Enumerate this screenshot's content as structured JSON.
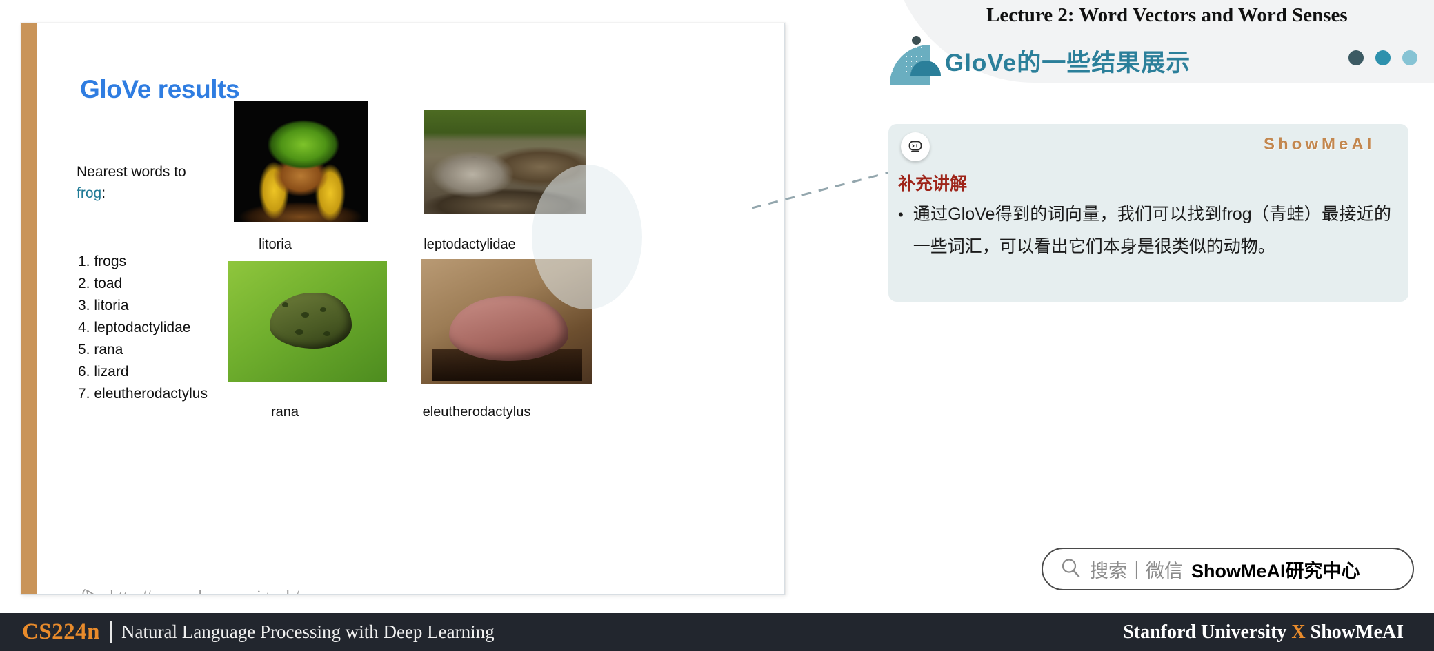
{
  "header": {
    "lecture_title": "Lecture 2:  Word Vectors and Word Senses",
    "cn_title": "GloVe的一些结果展示",
    "dots": [
      "dark-teal-dot",
      "teal-dot",
      "light-teal-dot"
    ]
  },
  "slide": {
    "title": "GloVe results",
    "nearest_label": "Nearest words to",
    "nearest_word": "frog",
    "nearest_colon": ":",
    "words": [
      "1. frogs",
      "2. toad",
      "3. litoria",
      "4. leptodactylidae",
      "5. rana",
      "6. lizard",
      "7. eleutherodactylus"
    ],
    "photos": [
      {
        "caption": "litoria",
        "alt": "green tree frog on black background"
      },
      {
        "caption": "leptodactylidae",
        "alt": "mottled grey frog among leaves"
      },
      {
        "caption": "rana",
        "alt": "green frog on a leaf"
      },
      {
        "caption": "eleutherodactylus",
        "alt": "pink-brown frog on wood"
      }
    ],
    "url": "http://www.showmeai.tech/",
    "url_icon": "cursor-arrow-icon"
  },
  "explanation": {
    "badge_icon": "robot-icon",
    "heading": "补充讲解",
    "bullet": "•",
    "body": "通过GloVe得到的词向量，我们可以找到frog（青蛙）最接近的一些词汇，可以看出它们本身是很类似的动物。"
  },
  "watermark": "ShowMeAI",
  "search": {
    "icon": "search-icon",
    "placeholder": "搜索｜微信",
    "brand": "ShowMeAI研究中心"
  },
  "footer": {
    "course_code": "CS224n",
    "course_name": "Natural Language Processing with Deep Learning",
    "affiliation_left": "Stanford University",
    "affiliation_x": "X",
    "affiliation_right": "ShowMeAI"
  },
  "colors": {
    "accent_orange": "#e98b2b",
    "slide_bar": "#c99459",
    "teal": "#2b7f9a",
    "title_blue": "#2f7de1",
    "heading_red": "#9e2419",
    "card_bg": "#e6eeef",
    "footer_bg": "#22262e"
  }
}
